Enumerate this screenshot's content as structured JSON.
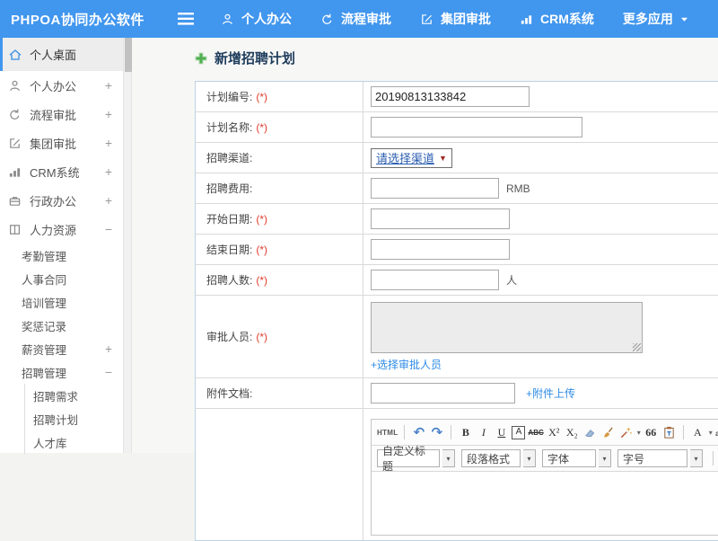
{
  "topbar": {
    "brand": "PHPOA协同办公软件",
    "nav": [
      {
        "name": "nav-personal-office",
        "label": "个人办公",
        "icon": "person-icon"
      },
      {
        "name": "nav-workflow-approval",
        "label": "流程审批",
        "icon": "flow-icon"
      },
      {
        "name": "nav-group-approval",
        "label": "集团审批",
        "icon": "edit-icon"
      },
      {
        "name": "nav-crm-system",
        "label": "CRM系统",
        "icon": "chart-icon"
      },
      {
        "name": "nav-more-apps",
        "label": "更多应用",
        "icon": "caret-down-icon",
        "caret_after": true
      }
    ]
  },
  "sidebar": {
    "items": [
      {
        "label": "个人桌面",
        "icon": "home-icon",
        "level": 0,
        "active": true
      },
      {
        "label": "个人办公",
        "icon": "person-icon",
        "level": 0,
        "expand": "+"
      },
      {
        "label": "流程审批",
        "icon": "flow-icon",
        "level": 0,
        "expand": "+"
      },
      {
        "label": "集团审批",
        "icon": "edit-icon",
        "level": 0,
        "expand": "+"
      },
      {
        "label": "CRM系统",
        "icon": "chart-icon",
        "level": 0,
        "expand": "+"
      },
      {
        "label": "行政办公",
        "icon": "briefcase-icon",
        "level": 0,
        "expand": "+"
      },
      {
        "label": "人力资源",
        "icon": "hr-icon",
        "level": 0,
        "expand": "−"
      },
      {
        "label": "考勤管理",
        "level": 1
      },
      {
        "label": "人事合同",
        "level": 1
      },
      {
        "label": "培训管理",
        "level": 1
      },
      {
        "label": "奖惩记录",
        "level": 1
      },
      {
        "label": "薪资管理",
        "level": 1,
        "expand": "+"
      },
      {
        "label": "招聘管理",
        "level": 1,
        "expand": "−"
      },
      {
        "label": "招聘需求",
        "level": 2
      },
      {
        "label": "招聘计划",
        "level": 2
      },
      {
        "label": "人才库",
        "level": 2
      }
    ]
  },
  "main": {
    "page_title": "新增招聘计划"
  },
  "form": {
    "required_mark": "(*)",
    "rows": [
      {
        "id": "plan-number",
        "label": "计划编号:",
        "required": true,
        "type": "text",
        "value": "20190813133842"
      },
      {
        "id": "plan-name",
        "label": "计划名称:",
        "required": true,
        "type": "text",
        "value": ""
      },
      {
        "id": "recruit-channel",
        "label": "招聘渠道:",
        "type": "select",
        "value": "请选择渠道"
      },
      {
        "id": "recruit-cost",
        "label": "招聘费用:",
        "type": "text",
        "value": "",
        "suffix": "RMB"
      },
      {
        "id": "start-date",
        "label": "开始日期:",
        "required": true,
        "type": "text",
        "value": ""
      },
      {
        "id": "end-date",
        "label": "结束日期:",
        "required": true,
        "type": "text",
        "value": ""
      },
      {
        "id": "headcount",
        "label": "招聘人数:",
        "required": true,
        "type": "text",
        "value": "",
        "suffix": "人"
      },
      {
        "id": "approvers",
        "label": "审批人员:",
        "required": true,
        "type": "textarea",
        "link": "+选择审批人员"
      },
      {
        "id": "attachment",
        "label": "附件文档:",
        "type": "text",
        "value": "",
        "link": "+附件上传"
      },
      {
        "id": "content",
        "label": "",
        "type": "editor"
      }
    ]
  },
  "editor": {
    "toolbar1": [
      {
        "kind": "text",
        "name": "html-source-button",
        "label": "HTML"
      },
      {
        "kind": "sep"
      },
      {
        "kind": "glyph",
        "name": "undo-icon",
        "glyph": "↶",
        "cls": "blue"
      },
      {
        "kind": "glyph",
        "name": "redo-icon",
        "glyph": "↷",
        "cls": "blue"
      },
      {
        "kind": "sep"
      },
      {
        "kind": "glyph",
        "name": "bold-icon",
        "glyph": "B",
        "cls": "serif bold"
      },
      {
        "kind": "glyph",
        "name": "italic-icon",
        "glyph": "I",
        "cls": "serif italic"
      },
      {
        "kind": "glyph",
        "name": "underline-icon",
        "glyph": "U",
        "cls": "serif underline"
      },
      {
        "kind": "glyph",
        "name": "font-border-icon",
        "glyph": "A",
        "cls": "boxed"
      },
      {
        "kind": "glyph",
        "name": "strikethrough-icon",
        "glyph": "ABC",
        "cls": "strike tiny"
      },
      {
        "kind": "glyph",
        "name": "superscript-icon",
        "glyph": "X²",
        "cls": "serif"
      },
      {
        "kind": "glyph",
        "name": "subscript-icon",
        "glyph": "X₂",
        "cls": "serif"
      },
      {
        "kind": "svg",
        "name": "eraser-icon"
      },
      {
        "kind": "svg",
        "name": "format-brush-icon"
      },
      {
        "kind": "svg",
        "name": "autotypeset-icon",
        "caret": true
      },
      {
        "kind": "glyph",
        "name": "blockquote-icon",
        "glyph": "66",
        "cls": "serif bold"
      },
      {
        "kind": "svg",
        "name": "paste-icon"
      },
      {
        "kind": "sep"
      },
      {
        "kind": "glyph",
        "name": "font-color-icon",
        "glyph": "A",
        "cls": "serif",
        "caret": true
      },
      {
        "kind": "svg",
        "name": "highlight-icon",
        "caret": true
      },
      {
        "kind": "sep"
      },
      {
        "kind": "svg",
        "name": "image-icon"
      }
    ],
    "toolbar2": [
      {
        "kind": "dropdown",
        "name": "custom-title-select",
        "label": "自定义标题"
      },
      {
        "kind": "dropdown",
        "name": "paragraph-format-select",
        "label": "段落格式"
      },
      {
        "kind": "dropdown",
        "name": "font-family-select",
        "label": "字体"
      },
      {
        "kind": "dropdown",
        "name": "font-size-select",
        "label": "字号"
      },
      {
        "kind": "sep"
      },
      {
        "kind": "svg",
        "name": "align-left-icon"
      },
      {
        "kind": "svg",
        "name": "align-center-icon"
      },
      {
        "kind": "svg",
        "name": "align-right-icon"
      },
      {
        "kind": "svg",
        "name": "align-justify-icon"
      },
      {
        "kind": "svg",
        "name": "link-icon"
      },
      {
        "kind": "svg",
        "name": "unlink-icon"
      }
    ]
  }
}
